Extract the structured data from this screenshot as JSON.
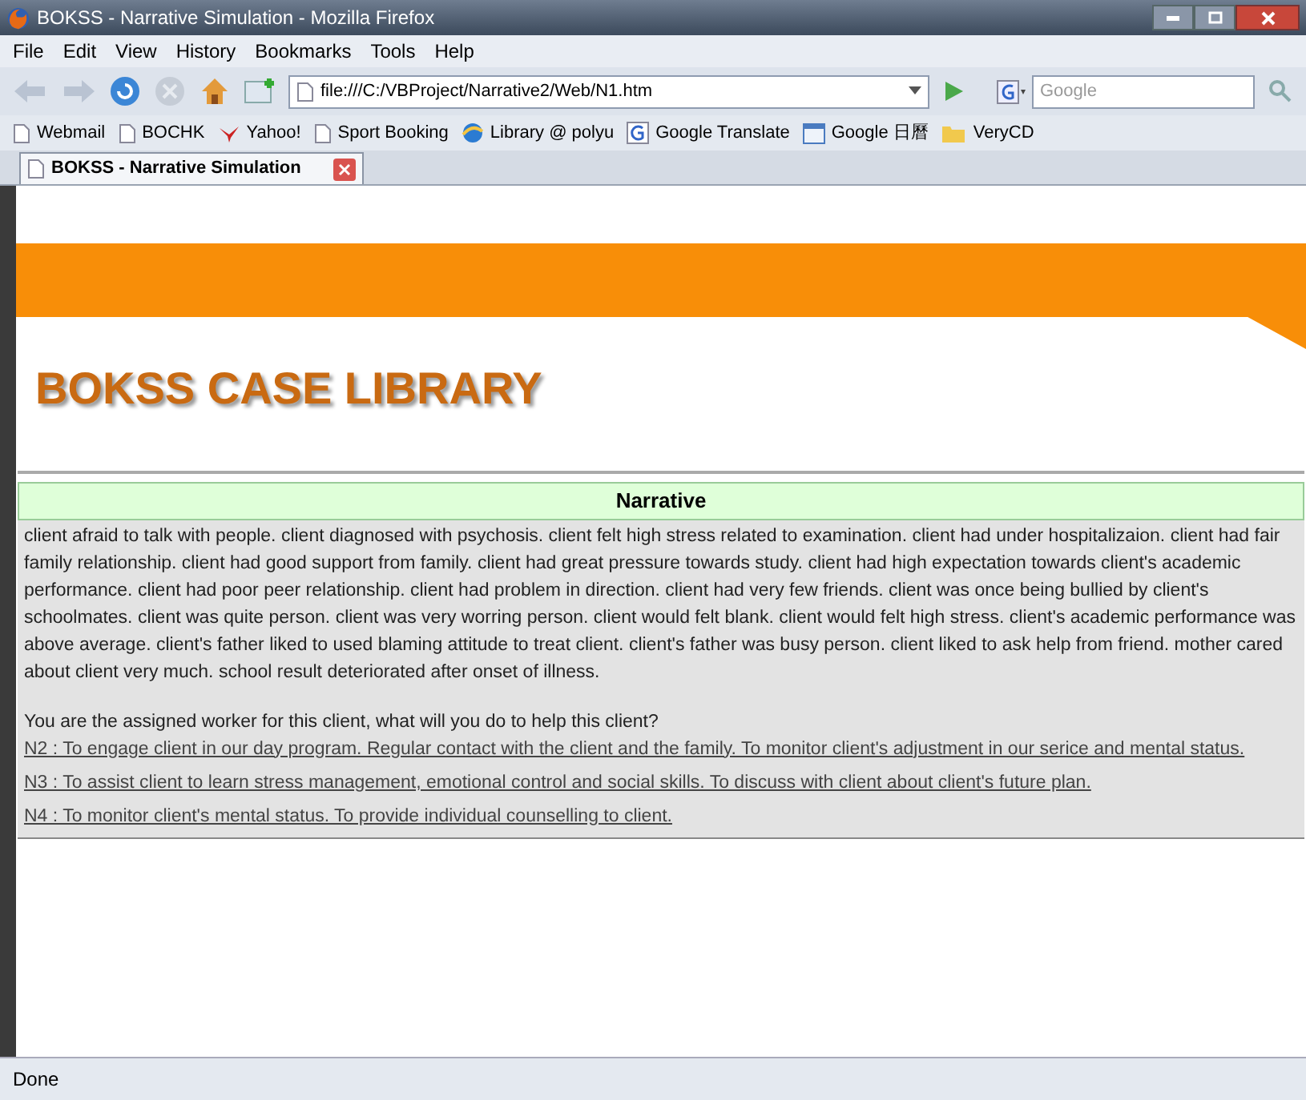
{
  "window": {
    "title": "BOKSS - Narrative Simulation - Mozilla Firefox"
  },
  "menu": [
    "File",
    "Edit",
    "View",
    "History",
    "Bookmarks",
    "Tools",
    "Help"
  ],
  "address": {
    "value": "file:///C:/VBProject/Narrative2/Web/N1.htm"
  },
  "search": {
    "placeholder": "Google"
  },
  "bookmarks": [
    {
      "label": "Webmail",
      "kind": "page"
    },
    {
      "label": "BOCHK",
      "kind": "page"
    },
    {
      "label": "Yahoo!",
      "kind": "yahoo"
    },
    {
      "label": "Sport Booking",
      "kind": "page"
    },
    {
      "label": "Library @ polyu",
      "kind": "ie"
    },
    {
      "label": "Google Translate",
      "kind": "google"
    },
    {
      "label": "Google 日曆",
      "kind": "calendar"
    },
    {
      "label": "VeryCD",
      "kind": "folder"
    }
  ],
  "tabs": [
    {
      "label": "BOKSS - Narrative Simulation",
      "selected": true
    }
  ],
  "page": {
    "heading": "BOKSS CASE LIBRARY",
    "section_title": "Narrative",
    "narrative": "client afraid to talk with people. client diagnosed with psychosis. client felt high stress related to examination. client had under hospitalizaion. client had fair family relationship. client had good support from family. client had great pressure towards study. client had high expectation towards client's academic performance. client had poor peer relationship. client had problem in direction. client had very few friends. client was once being bullied by client's schoolmates. client was quite person. client was very worring person. client would felt blank. client would felt high stress. client's academic performance was above average. client's father liked to used blaming attitude to treat client. client's father was busy person. client liked to ask help from friend. mother cared about client very much. school result deteriorated after onset of illness.",
    "question": "You are the assigned worker for this client, what will you do to help this client?",
    "options": [
      "N2 : To engage client in our day program. Regular contact with the client and the family. To monitor client's adjustment in our serice and mental status.",
      "N3 : To assist client to learn stress management, emotional control and social skills. To discuss with client about client's future plan.",
      "N4 : To monitor client's mental status. To provide individual counselling to client."
    ]
  },
  "status_bar": "Done"
}
